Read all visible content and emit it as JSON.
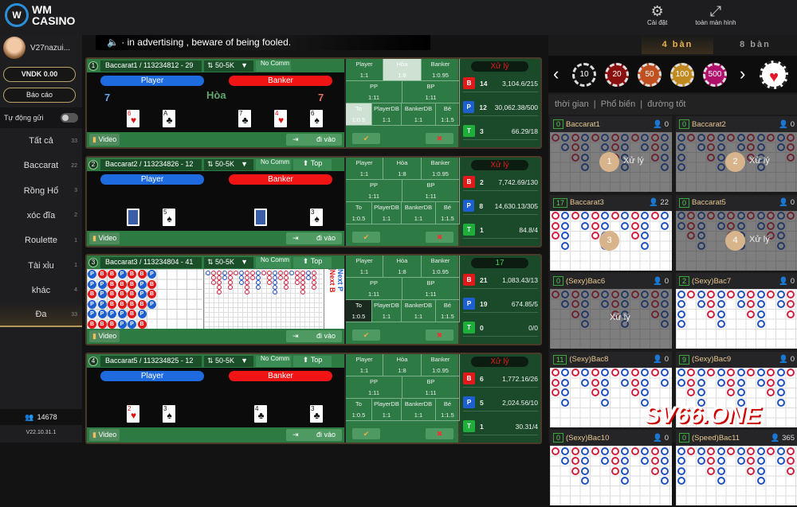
{
  "header": {
    "logo": "WM\nCASINO",
    "settings": "Cài đặt",
    "fullscreen": "toàn màn hình"
  },
  "sidebar": {
    "username": "V27nazui...",
    "balance": "VNDK 0.00",
    "report": "Báo cáo",
    "auto_send": "Tự động gửi",
    "items": [
      {
        "label": "Tất cả",
        "count": "33"
      },
      {
        "label": "Baccarat",
        "count": "22"
      },
      {
        "label": "Rồng Hổ",
        "count": "3"
      },
      {
        "label": "xóc đĩa",
        "count": "2"
      },
      {
        "label": "Roulette",
        "count": "1"
      },
      {
        "label": "Tài xỉu",
        "count": "1"
      },
      {
        "label": "khác",
        "count": "4"
      },
      {
        "label": "Đa",
        "count": "33",
        "active": true
      }
    ],
    "online": "14678",
    "version": "V22.10.31.1"
  },
  "marquee": "· in advertising , beware of being fooled.",
  "common": {
    "player": "Player",
    "banker": "Banker",
    "video": "Video",
    "enter": "đi vào",
    "no_comm": "No Comm",
    "top": "Top",
    "tie": "Hòa",
    "bets": [
      [
        "Player",
        "1:1"
      ],
      [
        "Hòa",
        "1:8"
      ],
      [
        "Banker",
        "1:0.95"
      ],
      [
        "PP",
        "1:11"
      ],
      [
        "BP",
        "1:11"
      ],
      [
        "To",
        "1:0.5"
      ],
      [
        "PlayerDB",
        "1:1"
      ],
      [
        "BankerDB",
        "1:1"
      ],
      [
        "Bé",
        "1:1.5"
      ]
    ]
  },
  "tables": [
    {
      "num": "1",
      "name": "Baccarat1 / 113234812 - 29",
      "limit": "50-5K",
      "top": false,
      "player_score": "7",
      "banker_score": "7",
      "result": "Hòa",
      "player_cards": [
        [
          "6",
          "♥"
        ],
        [
          "A",
          "♣"
        ]
      ],
      "banker_cards": [
        [
          "7",
          "♣"
        ],
        [
          "4",
          "♥"
        ],
        [
          "6",
          "♠"
        ]
      ],
      "status": "Xử lý",
      "status_color": "#e02020",
      "stats": [
        [
          "B",
          "14",
          "3,104.6/215"
        ],
        [
          "P",
          "12",
          "30,062.38/500"
        ],
        [
          "T",
          "3",
          "66.29/18"
        ]
      ]
    },
    {
      "num": "2",
      "name": "Baccarat2 / 113234826 - 12",
      "limit": "50-5K",
      "top": true,
      "player_score": "",
      "banker_score": "",
      "result": "",
      "player_cards": [
        [
          "?",
          "back"
        ],
        [
          "5",
          "♠"
        ]
      ],
      "banker_cards": [
        [
          "?",
          "back"
        ],
        [
          "3",
          "♠"
        ]
      ],
      "status": "Xử lý",
      "status_color": "#e02020",
      "stats": [
        [
          "B",
          "2",
          "7,742.69/130"
        ],
        [
          "P",
          "8",
          "14,630.13/305"
        ],
        [
          "T",
          "1",
          "84.8/4"
        ]
      ]
    },
    {
      "num": "3",
      "name": "Baccarat3 / 113234804 - 41",
      "limit": "50-5K",
      "top": true,
      "roadmap": true,
      "next_p": "Next P",
      "next_b": "Next B",
      "bead_road": [
        "PBBPBBP",
        "PPBBBPB",
        "BPBBBPB",
        "PPBBBBP",
        "PPPPBP",
        "BBBPPB"
      ],
      "status": "17",
      "status_color": "#3fcf4f",
      "stats": [
        [
          "B",
          "21",
          "1,083.43/13"
        ],
        [
          "P",
          "19",
          "674.85/5"
        ],
        [
          "T",
          "0",
          "0/0"
        ]
      ]
    },
    {
      "num": "4",
      "name": "Baccarat5 / 113234825 - 12",
      "limit": "50-5K",
      "top": true,
      "player_score": "",
      "banker_score": "",
      "result": "",
      "player_cards": [
        [
          "2",
          "♥"
        ],
        [
          "3",
          "♠"
        ]
      ],
      "banker_cards": [
        [
          "4",
          "♣"
        ],
        [
          "3",
          "♣"
        ]
      ],
      "status": "Xử lý",
      "status_color": "#e02020",
      "stats": [
        [
          "B",
          "6",
          "1,772.16/26"
        ],
        [
          "P",
          "5",
          "2,024.56/10"
        ],
        [
          "T",
          "1",
          "30.31/4"
        ]
      ]
    }
  ],
  "right_panel": {
    "tabs": [
      {
        "label": "4 bàn",
        "active": true
      },
      {
        "label": "8 bàn",
        "active": false
      }
    ],
    "chips": [
      {
        "value": "10",
        "color": "#111"
      },
      {
        "value": "20",
        "color": "#8a1010"
      },
      {
        "value": "50",
        "color": "#c05020"
      },
      {
        "value": "100",
        "color": "#c08a20"
      },
      {
        "value": "500",
        "color": "#b0106a"
      }
    ],
    "filters": "thời gian  |  Phổ biến  |  đường tốt",
    "processing": "Xử lý",
    "tables": [
      {
        "num": "0",
        "name": "Baccarat1",
        "players": "0",
        "badge": "1",
        "dim": true
      },
      {
        "num": "0",
        "name": "Baccarat2",
        "players": "0",
        "badge": "2",
        "dim": true
      },
      {
        "num": "17",
        "name": "Baccarat3",
        "players": "22",
        "badge": "3",
        "dim": false
      },
      {
        "num": "0",
        "name": "Baccarat5",
        "players": "0",
        "badge": "4",
        "dim": true
      },
      {
        "num": "0",
        "name": "(Sexy)Bac6",
        "players": "0",
        "dim": true,
        "processing": true
      },
      {
        "num": "2",
        "name": "(Sexy)Bac7",
        "players": "0",
        "dim": false
      },
      {
        "num": "11",
        "name": "(Sexy)Bac8",
        "players": "0",
        "dim": false
      },
      {
        "num": "9",
        "name": "(Sexy)Bac9",
        "players": "0",
        "dim": false
      },
      {
        "num": "0",
        "name": "(Sexy)Bac10",
        "players": "0",
        "dim": false
      },
      {
        "num": "0",
        "name": "(Speed)Bac11",
        "players": "365",
        "dim": false
      }
    ]
  },
  "watermark": "SV66.ONE",
  "colors": {
    "player": "#1e6be0",
    "banker": "#f01414",
    "tie": "#1fae3a",
    "felt": "#2d7a42",
    "gold": "#b8955a"
  }
}
